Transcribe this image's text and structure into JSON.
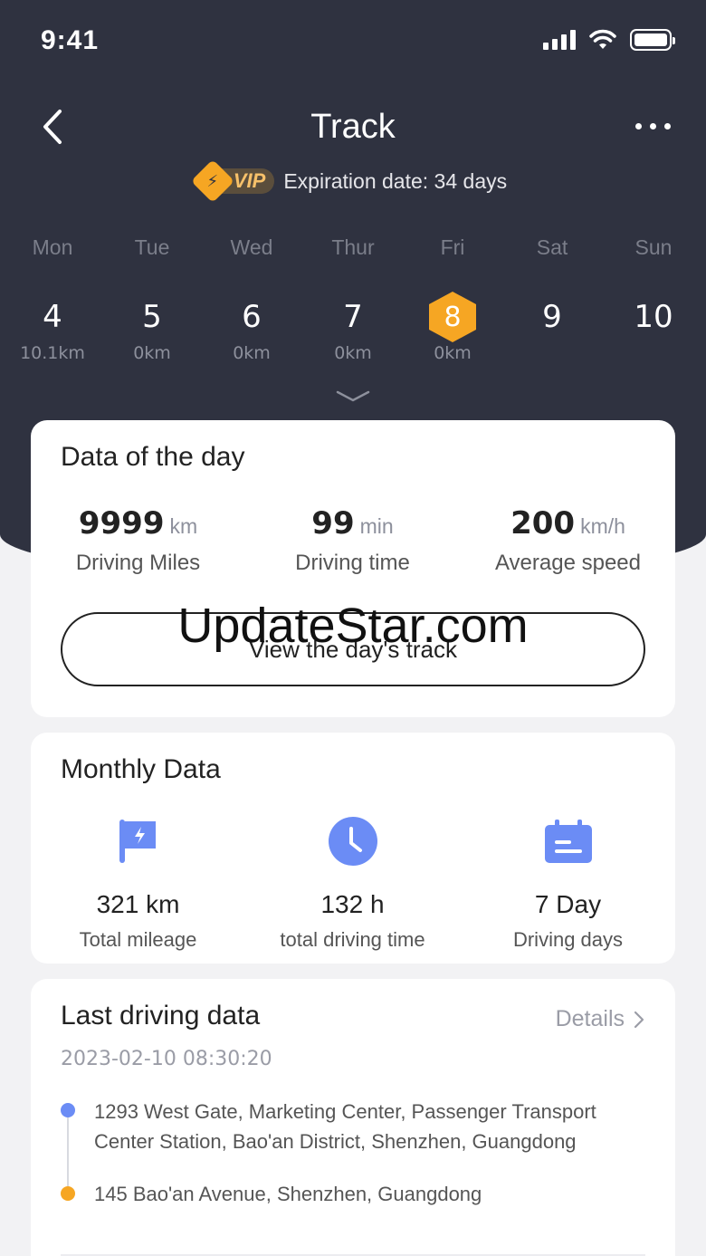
{
  "status": {
    "time": "9:41"
  },
  "nav": {
    "title": "Track"
  },
  "vip": {
    "badge": "VIP",
    "expiration": "Expiration date: 34 days"
  },
  "week": [
    {
      "name": "Mon",
      "num": "4",
      "km": "10.1km"
    },
    {
      "name": "Tue",
      "num": "5",
      "km": "0km"
    },
    {
      "name": "Wed",
      "num": "6",
      "km": "0km"
    },
    {
      "name": "Thur",
      "num": "7",
      "km": "0km"
    },
    {
      "name": "Fri",
      "num": "8",
      "km": "0km",
      "selected": true
    },
    {
      "name": "Sat",
      "num": "9",
      "km": ""
    },
    {
      "name": "Sun",
      "num": "10",
      "km": ""
    }
  ],
  "day_card": {
    "title": "Data of the day",
    "stats": [
      {
        "value": "9999",
        "unit": "km",
        "label": "Driving Miles"
      },
      {
        "value": "99",
        "unit": "min",
        "label": "Driving time"
      },
      {
        "value": "200",
        "unit": "km/h",
        "label": "Average speed"
      }
    ],
    "button": "View the day's track"
  },
  "watermark": "UpdateStar.com",
  "monthly": {
    "title": "Monthly Data",
    "stats": [
      {
        "icon": "flag-icon",
        "value": "321 km",
        "label": "Total mileage"
      },
      {
        "icon": "clock-icon",
        "value": "132 h",
        "label": "total driving time"
      },
      {
        "icon": "calendar-icon",
        "value": "7 Day",
        "label": "Driving days"
      }
    ]
  },
  "last": {
    "title": "Last driving data",
    "details": "Details",
    "date": "2023-02-10 08:30:20",
    "start": "1293 West Gate, Marketing Center, Passenger Transport Center Station, Bao'an District, Shenzhen, Guangdong",
    "end": "145 Bao'an Avenue, Shenzhen, Guangdong"
  },
  "colors": {
    "header": "#2f3240",
    "accent": "#f6a623",
    "icon_blue": "#6b8cf5"
  }
}
